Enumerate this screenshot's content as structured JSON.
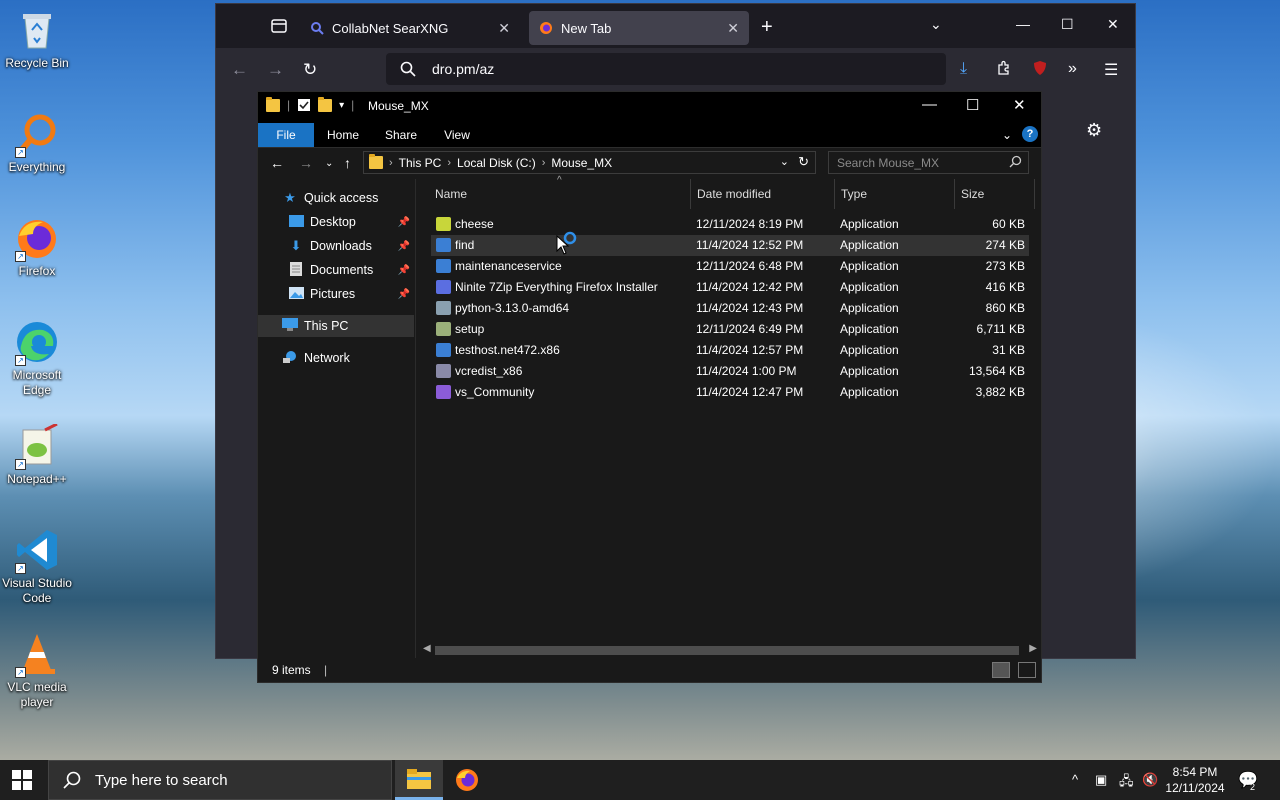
{
  "desktop": {
    "icons": [
      {
        "label": "Recycle Bin"
      },
      {
        "label": "Everything"
      },
      {
        "label": "Firefox"
      },
      {
        "label": "Microsoft Edge"
      },
      {
        "label": "Notepad++"
      },
      {
        "label": "Visual Studio Code"
      },
      {
        "label": "VLC media player"
      }
    ]
  },
  "firefox": {
    "tabs": [
      {
        "title": "CollabNet SearXNG"
      },
      {
        "title": "New Tab"
      }
    ],
    "url": "dro.pm/az"
  },
  "explorer": {
    "title": "Mouse_MX",
    "ribbon": {
      "file": "File",
      "home": "Home",
      "share": "Share",
      "view": "View"
    },
    "breadcrumb": [
      "This PC",
      "Local Disk (C:)",
      "Mouse_MX"
    ],
    "search_placeholder": "Search Mouse_MX",
    "nav": {
      "quick_access": "Quick access",
      "desktop": "Desktop",
      "downloads": "Downloads",
      "documents": "Documents",
      "pictures": "Pictures",
      "this_pc": "This PC",
      "network": "Network"
    },
    "columns": {
      "name": "Name",
      "date": "Date modified",
      "type": "Type",
      "size": "Size"
    },
    "files": [
      {
        "name": "cheese",
        "date": "12/11/2024 8:19 PM",
        "type": "Application",
        "size": "60 KB",
        "icon": "cheese-icon",
        "color": "#c8d63a"
      },
      {
        "name": "find",
        "date": "11/4/2024 12:52 PM",
        "type": "Application",
        "size": "274 KB",
        "icon": "app-window-icon",
        "color": "#3b7fd4"
      },
      {
        "name": "maintenanceservice",
        "date": "12/11/2024 6:48 PM",
        "type": "Application",
        "size": "273 KB",
        "icon": "app-window-icon",
        "color": "#3b7fd4"
      },
      {
        "name": "Ninite 7Zip Everything Firefox Installer",
        "date": "11/4/2024 12:42 PM",
        "type": "Application",
        "size": "416 KB",
        "icon": "ninite-icon",
        "color": "#5b6ee1"
      },
      {
        "name": "python-3.13.0-amd64",
        "date": "11/4/2024 12:43 PM",
        "type": "Application",
        "size": "860 KB",
        "icon": "python-installer-icon",
        "color": "#8aa0b0"
      },
      {
        "name": "setup",
        "date": "12/11/2024 6:49 PM",
        "type": "Application",
        "size": "6,711 KB",
        "icon": "setup-icon",
        "color": "#9bb07a"
      },
      {
        "name": "testhost.net472.x86",
        "date": "11/4/2024 12:57 PM",
        "type": "Application",
        "size": "31 KB",
        "icon": "app-window-icon",
        "color": "#3b7fd4"
      },
      {
        "name": "vcredist_x86",
        "date": "11/4/2024 1:00 PM",
        "type": "Application",
        "size": "13,564 KB",
        "icon": "vcredist-icon",
        "color": "#8a8aa8"
      },
      {
        "name": "vs_Community",
        "date": "11/4/2024 12:47 PM",
        "type": "Application",
        "size": "3,882 KB",
        "icon": "visual-studio-icon",
        "color": "#8b5cd8"
      }
    ],
    "status": "9 items"
  },
  "taskbar": {
    "search_placeholder": "Type here to search",
    "time": "8:54 PM",
    "date": "12/11/2024",
    "notifications": "2"
  }
}
